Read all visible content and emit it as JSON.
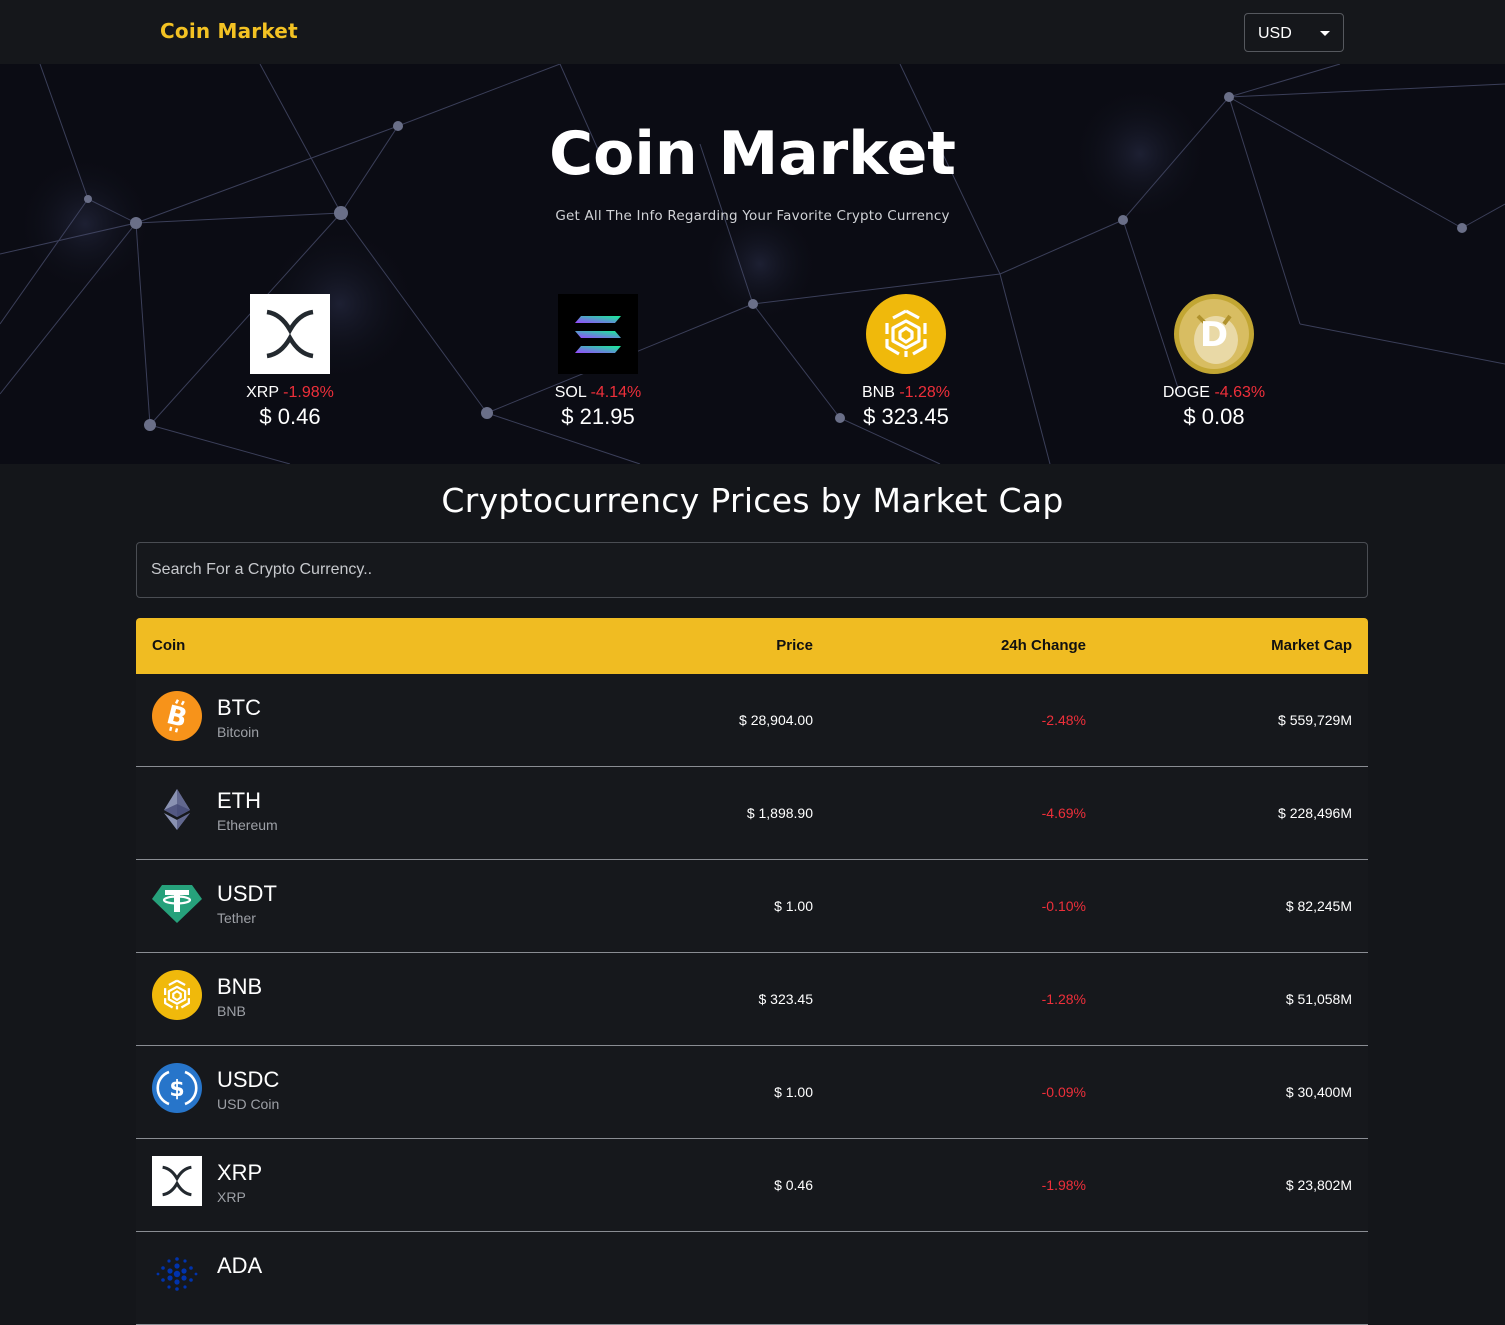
{
  "nav": {
    "brand": "Coin Market",
    "currency_selected": "USD"
  },
  "hero": {
    "title": "Coin Market",
    "subtitle": "Get All The Info Regarding Your Favorite Crypto Currency"
  },
  "trending": [
    {
      "symbol": "XRP",
      "change": "-1.98%",
      "price": "$ 0.46",
      "icon": "xrp-icon"
    },
    {
      "symbol": "SOL",
      "change": "-4.14%",
      "price": "$ 21.95",
      "icon": "sol-icon"
    },
    {
      "symbol": "BNB",
      "change": "-1.28%",
      "price": "$ 323.45",
      "icon": "bnb-icon"
    },
    {
      "symbol": "DOGE",
      "change": "-4.63%",
      "price": "$ 0.08",
      "icon": "doge-icon"
    }
  ],
  "main": {
    "section_title": "Cryptocurrency Prices by Market Cap",
    "search_placeholder": "Search For a Crypto Currency.."
  },
  "table": {
    "headers": {
      "coin": "Coin",
      "price": "Price",
      "change": "24h Change",
      "market_cap": "Market Cap"
    },
    "rows": [
      {
        "symbol": "BTC",
        "name": "Bitcoin",
        "price": "$ 28,904.00",
        "change": "-2.48%",
        "market_cap": "$ 559,729M",
        "icon": "btc-icon"
      },
      {
        "symbol": "ETH",
        "name": "Ethereum",
        "price": "$ 1,898.90",
        "change": "-4.69%",
        "market_cap": "$ 228,496M",
        "icon": "eth-icon"
      },
      {
        "symbol": "USDT",
        "name": "Tether",
        "price": "$ 1.00",
        "change": "-0.10%",
        "market_cap": "$ 82,245M",
        "icon": "usdt-icon"
      },
      {
        "symbol": "BNB",
        "name": "BNB",
        "price": "$ 323.45",
        "change": "-1.28%",
        "market_cap": "$ 51,058M",
        "icon": "bnb-icon"
      },
      {
        "symbol": "USDC",
        "name": "USD Coin",
        "price": "$ 1.00",
        "change": "-0.09%",
        "market_cap": "$ 30,400M",
        "icon": "usdc-icon"
      },
      {
        "symbol": "XRP",
        "name": "XRP",
        "price": "$ 0.46",
        "change": "-1.98%",
        "market_cap": "$ 23,802M",
        "icon": "xrp-icon"
      },
      {
        "symbol": "ADA",
        "name": "",
        "price": "",
        "change": "",
        "market_cap": "",
        "icon": "ada-icon"
      }
    ]
  },
  "colors": {
    "accent": "#f0bc22",
    "brand": "#f3c223",
    "negative": "#ee2f3a",
    "background": "#14161a"
  }
}
